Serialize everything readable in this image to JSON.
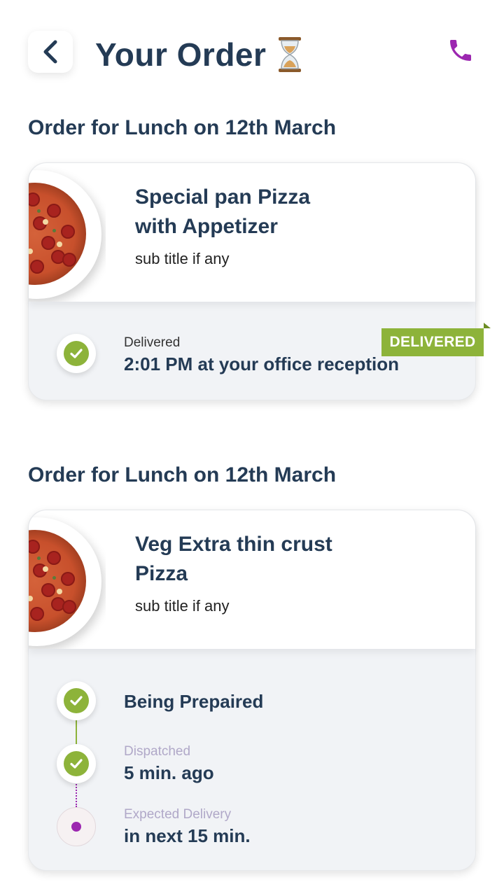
{
  "header": {
    "title": "Your Order",
    "hourglass_icon": "hourglass-icon",
    "back_icon": "chevron-left-icon",
    "phone_icon": "phone-icon",
    "phone_color": "#9c27b0"
  },
  "orders": [
    {
      "heading": "Order for Lunch on 12th March",
      "item_title_line1": "Special pan Pizza",
      "item_title_line2": "with Appetizer",
      "subtitle": "sub title if any",
      "badge": "DELIVERED",
      "status_label": "Delivered",
      "status_value": "2:01 PM at your office reception"
    },
    {
      "heading": "Order for Lunch on 12th March",
      "item_title_line1": "Veg Extra thin crust",
      "item_title_line2": "Pizza",
      "subtitle": "sub title if any",
      "steps": [
        {
          "label": "",
          "value": "Being Prepaired",
          "state": "done"
        },
        {
          "label": "Dispatched",
          "value": "5 min. ago",
          "state": "done"
        },
        {
          "label": "Expected Delivery",
          "value": "in next 15 min.",
          "state": "pending"
        }
      ]
    }
  ],
  "colors": {
    "accent_green": "#8db33a",
    "accent_purple": "#9c27b0",
    "text_dark": "#243b55"
  }
}
